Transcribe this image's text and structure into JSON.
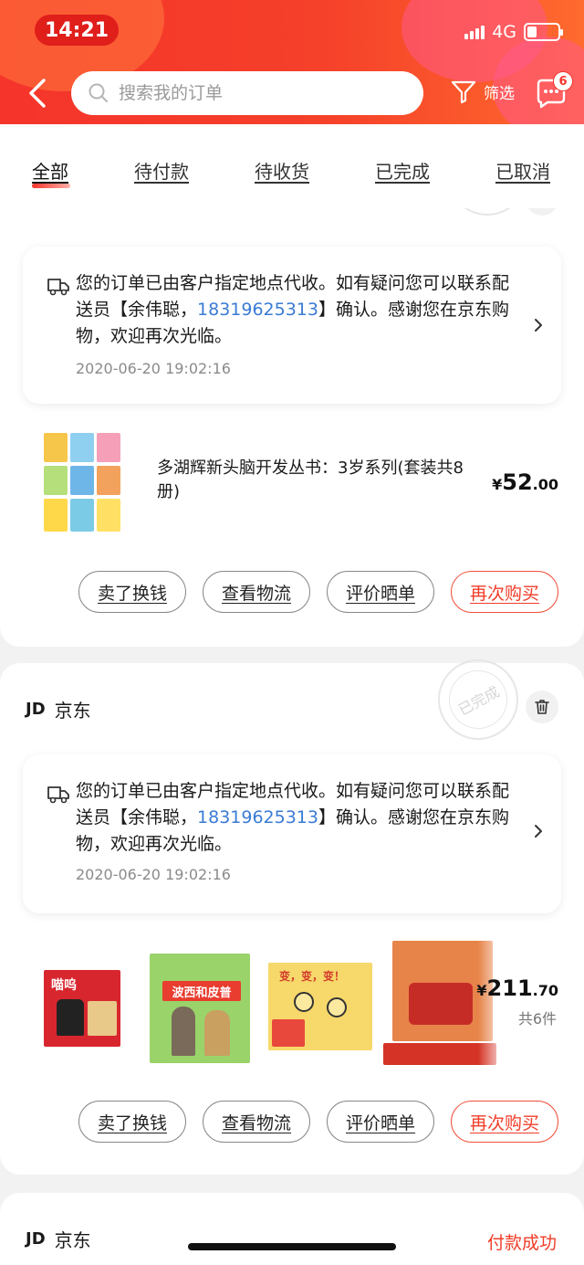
{
  "status_bar": {
    "time": "14:21",
    "network": "4G"
  },
  "header": {
    "search_placeholder": "搜索我的订单",
    "filter_label": "筛选",
    "message_badge": "6"
  },
  "tabs": [
    {
      "label": "全部",
      "active": true
    },
    {
      "label": "待付款"
    },
    {
      "label": "待收货"
    },
    {
      "label": "已完成"
    },
    {
      "label": "已取消"
    }
  ],
  "orders": [
    {
      "notice": {
        "text_before": "您的订单已由客户指定地点代收。如有疑问您可以联系配送员【余伟聪，",
        "phone": "18319625313",
        "text_after": "】确认。感谢您在京东购物，欢迎再次光临。",
        "time": "2020-06-20 19:02:16"
      },
      "product_title": "多湖辉新头脑开发丛书：3岁系列(套装共8册)",
      "price_symbol": "¥",
      "price_int": "52",
      "price_dec": ".00",
      "buttons": [
        "卖了换钱",
        "查看物流",
        "评价晒单",
        "再次购买"
      ]
    },
    {
      "shop_logo": "JD",
      "shop_name": "京东",
      "stamp_text": "已完成",
      "notice": {
        "text_before": "您的订单已由客户指定地点代收。如有疑问您可以联系配送员【余伟聪，",
        "phone": "18319625313",
        "text_after": "】确认。感谢您在京东购物，欢迎再次光临。",
        "time": "2020-06-20 19:02:16"
      },
      "price_symbol": "¥",
      "price_int": "211",
      "price_dec": ".70",
      "item_count": "共6件",
      "book_titles": [
        "喵呜",
        "波西和皮普",
        "变，变，变！"
      ],
      "buttons": [
        "卖了换钱",
        "查看物流",
        "评价晒单",
        "再次购买"
      ]
    },
    {
      "shop_logo": "JD",
      "shop_name": "京东",
      "status": "付款成功"
    }
  ],
  "colors": {
    "brand_red": "#f5342b",
    "link_blue": "#3a7bd5",
    "button_red": "#f03c28"
  }
}
